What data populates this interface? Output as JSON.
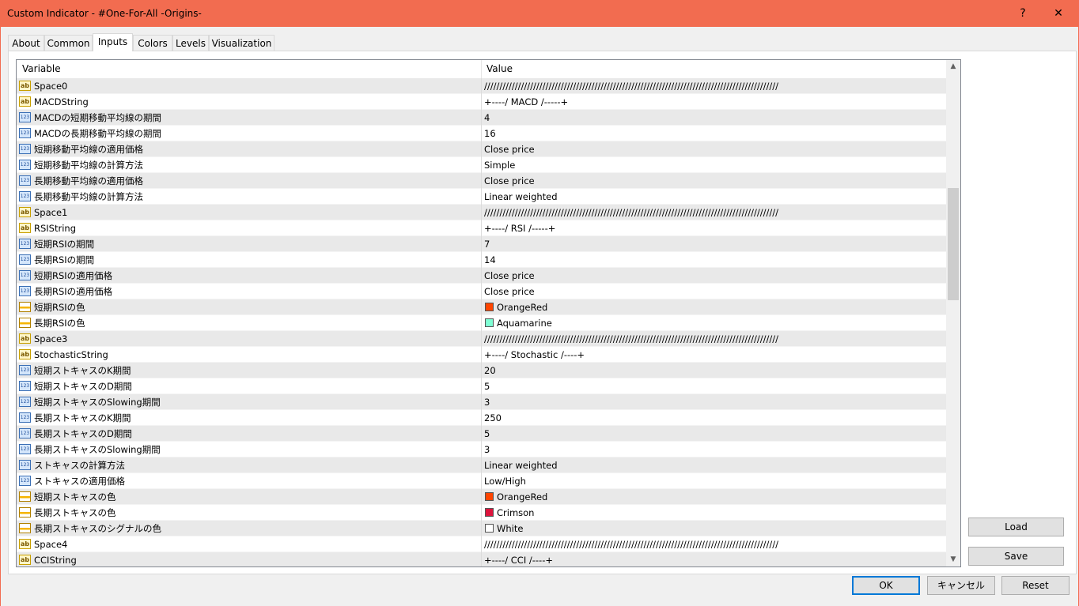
{
  "window": {
    "title": "Custom Indicator - #One-For-All -Origins-",
    "help_label": "?",
    "close_label": "✕"
  },
  "tabs": [
    {
      "label": "About"
    },
    {
      "label": "Common"
    },
    {
      "label": "Inputs"
    },
    {
      "label": "Colors"
    },
    {
      "label": "Levels"
    },
    {
      "label": "Visualization"
    }
  ],
  "active_tab": "Inputs",
  "grid": {
    "headers": {
      "variable": "Variable",
      "value": "Value"
    },
    "rows": [
      {
        "type": "string",
        "name": "Space0",
        "value": "////////////////////////////////////////////////////////////////////////////////////////////////"
      },
      {
        "type": "string",
        "name": "MACDString",
        "value": "+----/ MACD /-----+"
      },
      {
        "type": "number",
        "name": "MACDの短期移動平均線の期間",
        "value": "4"
      },
      {
        "type": "number",
        "name": "MACDの長期移動平均線の期間",
        "value": "16"
      },
      {
        "type": "number",
        "name": "短期移動平均線の適用価格",
        "value": "Close price"
      },
      {
        "type": "number",
        "name": "短期移動平均線の計算方法",
        "value": "Simple"
      },
      {
        "type": "number",
        "name": "長期移動平均線の適用価格",
        "value": "Close price"
      },
      {
        "type": "number",
        "name": "長期移動平均線の計算方法",
        "value": "Linear weighted"
      },
      {
        "type": "string",
        "name": "Space1",
        "value": "////////////////////////////////////////////////////////////////////////////////////////////////"
      },
      {
        "type": "string",
        "name": "RSIString",
        "value": "+----/ RSI /-----+"
      },
      {
        "type": "number",
        "name": "短期RSIの期間",
        "value": "7"
      },
      {
        "type": "number",
        "name": "長期RSIの期間",
        "value": "14"
      },
      {
        "type": "number",
        "name": "短期RSIの適用価格",
        "value": "Close price"
      },
      {
        "type": "number",
        "name": "長期RSIの適用価格",
        "value": "Close price"
      },
      {
        "type": "color",
        "name": "短期RSIの色",
        "value": "OrangeRed",
        "swatch": "#ff4500"
      },
      {
        "type": "color",
        "name": "長期RSIの色",
        "value": "Aquamarine",
        "swatch": "#7fffd4"
      },
      {
        "type": "string",
        "name": "Space3",
        "value": "////////////////////////////////////////////////////////////////////////////////////////////////"
      },
      {
        "type": "string",
        "name": "StochasticString",
        "value": "+----/ Stochastic /----+"
      },
      {
        "type": "number",
        "name": "短期ストキャスのK期間",
        "value": "20"
      },
      {
        "type": "number",
        "name": "短期ストキャスのD期間",
        "value": "5"
      },
      {
        "type": "number",
        "name": "短期ストキャスのSlowing期間",
        "value": "3"
      },
      {
        "type": "number",
        "name": "長期ストキャスのK期間",
        "value": "250"
      },
      {
        "type": "number",
        "name": "長期ストキャスのD期間",
        "value": "5"
      },
      {
        "type": "number",
        "name": "長期ストキャスのSlowing期間",
        "value": "3"
      },
      {
        "type": "number",
        "name": "ストキャスの計算方法",
        "value": "Linear weighted"
      },
      {
        "type": "number",
        "name": "ストキャスの適用価格",
        "value": "Low/High"
      },
      {
        "type": "color",
        "name": "短期ストキャスの色",
        "value": "OrangeRed",
        "swatch": "#ff4500"
      },
      {
        "type": "color",
        "name": "長期ストキャスの色",
        "value": "Crimson",
        "swatch": "#dc143c"
      },
      {
        "type": "color",
        "name": "長期ストキャスのシグナルの色",
        "value": "White",
        "swatch": "#ffffff"
      },
      {
        "type": "string",
        "name": "Space4",
        "value": "////////////////////////////////////////////////////////////////////////////////////////////////"
      },
      {
        "type": "string",
        "name": "CCIString",
        "value": "+----/ CCI /----+"
      }
    ]
  },
  "icons": {
    "string": "ab",
    "number": "123",
    "color": "color-icon"
  },
  "buttons": {
    "load": "Load",
    "save": "Save",
    "ok": "OK",
    "cancel": "キャンセル",
    "reset": "Reset"
  },
  "colors": {
    "titlebar": "#f26c50",
    "ok_border": "#0078d7"
  }
}
